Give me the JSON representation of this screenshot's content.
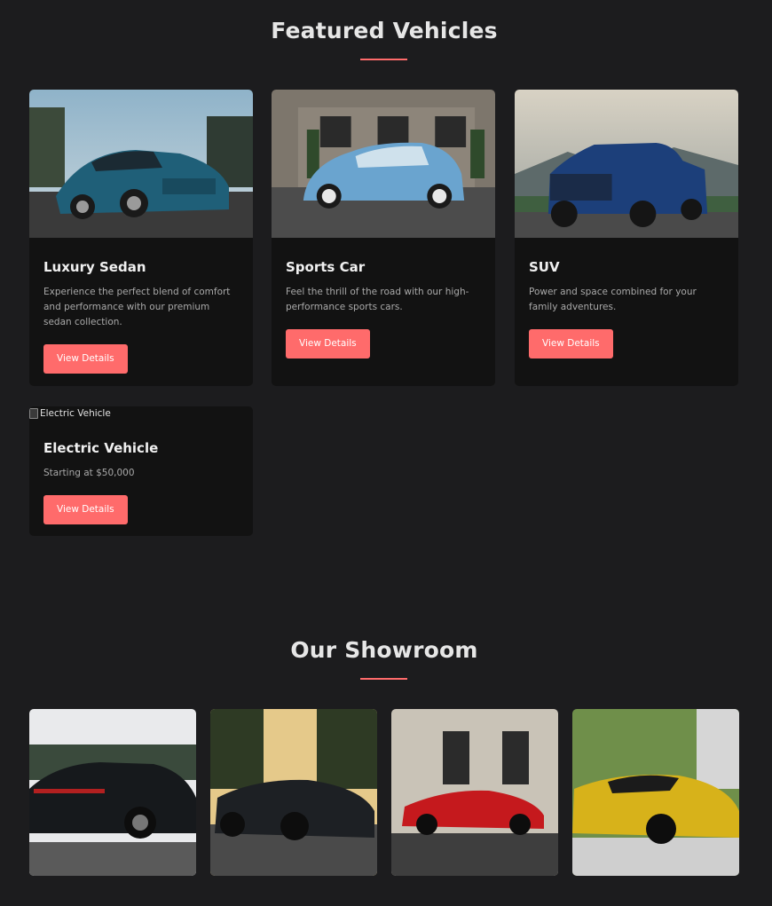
{
  "featured": {
    "title": "Featured Vehicles",
    "cards": [
      {
        "title": "Luxury Sedan",
        "description": "Experience the perfect blend of comfort and performance with our premium sedan collection.",
        "button": "View Details"
      },
      {
        "title": "Sports Car",
        "description": "Feel the thrill of the road with our high-performance sports cars.",
        "button": "View Details"
      },
      {
        "title": "SUV",
        "description": "Power and space combined for your family adventures.",
        "button": "View Details"
      },
      {
        "title": "Electric Vehicle",
        "image_alt": "Electric Vehicle",
        "description": "Starting at $50,000",
        "button": "View Details"
      }
    ]
  },
  "showroom": {
    "title": "Our Showroom"
  },
  "colors": {
    "background": "#1c1c1e",
    "card": "#121212",
    "accent": "#ff6b6b"
  }
}
